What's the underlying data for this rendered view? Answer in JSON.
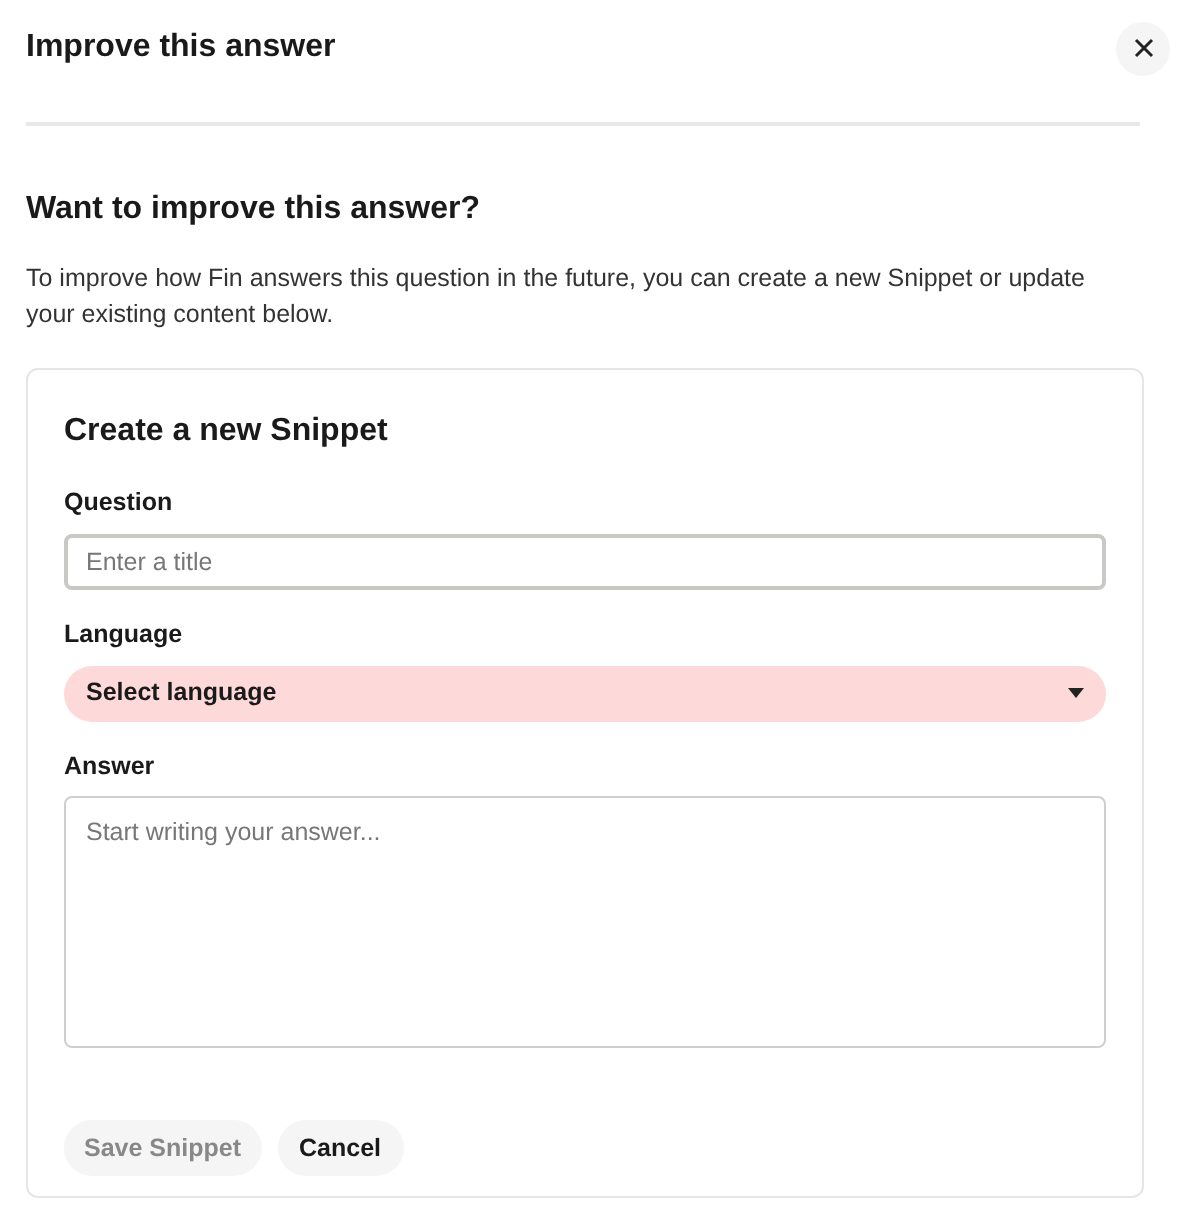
{
  "window": {
    "title": "Improve this answer"
  },
  "intro": {
    "heading": "Want to improve this answer?",
    "text": "To improve how Fin answers this question in the future, you can create a new Snippet or update your existing content below."
  },
  "form": {
    "title": "Create a new Snippet",
    "fields": [
      {
        "kind": "text",
        "label": "Question",
        "placeholder": "Enter a title"
      },
      {
        "kind": "select",
        "label": "Language",
        "value": "Select language",
        "invalid": true
      },
      {
        "kind": "textarea",
        "label": "Answer",
        "placeholder": "Start writing your answer..."
      }
    ],
    "buttons": [
      {
        "label": "Save Snippet",
        "disabled": true
      },
      {
        "label": "Cancel",
        "disabled": false
      }
    ]
  }
}
